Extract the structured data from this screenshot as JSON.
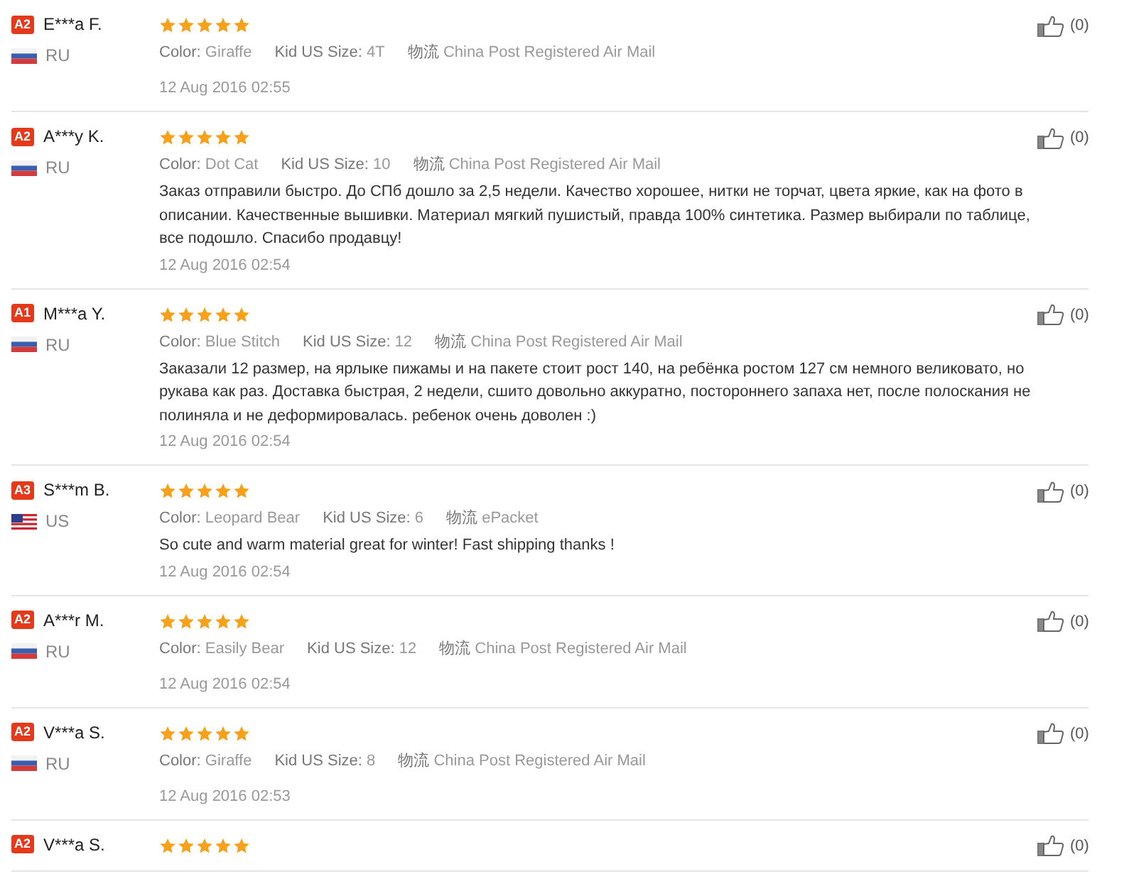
{
  "reviews": [
    {
      "badge": "A2",
      "name": "E***a F.",
      "country": "RU",
      "stars": 5,
      "attributes": [
        {
          "label": "Color:",
          "value": "Giraffe"
        },
        {
          "label": "Kid US Size:",
          "value": "4T"
        },
        {
          "label": "物流",
          "value": "China Post Registered Air Mail"
        }
      ],
      "date": "12 Aug 2016 02:55",
      "likes": "(0)"
    },
    {
      "badge": "A2",
      "name": "A***y K.",
      "country": "RU",
      "stars": 5,
      "attributes": [
        {
          "label": "Color:",
          "value": "Dot Cat"
        },
        {
          "label": "Kid US Size:",
          "value": "10"
        },
        {
          "label": "物流",
          "value": "China Post Registered Air Mail"
        }
      ],
      "text": "Заказ отправили быстро. До СПб дошло за 2,5 недели. Качество хорошее, нитки не торчат, цвета яркие, как на фото в описании. Качественные вышивки. Материал мягкий пушистый, правда 100% синтетика. Размер выбирали по таблице, все подошло. Спасибо продавцу!",
      "date": "12 Aug 2016 02:54",
      "likes": "(0)"
    },
    {
      "badge": "A1",
      "name": "M***a Y.",
      "country": "RU",
      "stars": 5,
      "attributes": [
        {
          "label": "Color:",
          "value": "Blue Stitch"
        },
        {
          "label": "Kid US Size:",
          "value": "12"
        },
        {
          "label": "物流",
          "value": "China Post Registered Air Mail"
        }
      ],
      "text": "Заказали 12 размер, на ярлыке пижамы и на пакете стоит рост 140, на ребёнка ростом 127 см немного великовато, но рукава как раз. Доставка быстрая, 2 недели, сшито довольно аккуратно, постороннего запаха нет, после полоскания не полиняла и не деформировалась. ребенок очень доволен :)",
      "date": "12 Aug 2016 02:54",
      "likes": "(0)"
    },
    {
      "badge": "A3",
      "name": "S***m B.",
      "country": "US",
      "stars": 5,
      "attributes": [
        {
          "label": "Color:",
          "value": "Leopard Bear"
        },
        {
          "label": "Kid US Size:",
          "value": "6"
        },
        {
          "label": "物流",
          "value": "ePacket"
        }
      ],
      "text": "So cute and warm material great for winter! Fast shipping thanks !",
      "date": "12 Aug 2016 02:54",
      "likes": "(0)"
    },
    {
      "badge": "A2",
      "name": "A***r M.",
      "country": "RU",
      "stars": 5,
      "attributes": [
        {
          "label": "Color:",
          "value": "Easily Bear"
        },
        {
          "label": "Kid US Size:",
          "value": "12"
        },
        {
          "label": "物流",
          "value": "China Post Registered Air Mail"
        }
      ],
      "date": "12 Aug 2016 02:54",
      "likes": "(0)"
    },
    {
      "badge": "A2",
      "name": "V***a S.",
      "country": "RU",
      "stars": 5,
      "attributes": [
        {
          "label": "Color:",
          "value": "Giraffe"
        },
        {
          "label": "Kid US Size:",
          "value": "8"
        },
        {
          "label": "物流",
          "value": "China Post Registered Air Mail"
        }
      ],
      "date": "12 Aug 2016 02:53",
      "likes": "(0)"
    },
    {
      "badge": "A2",
      "name": "V***a S.",
      "stars": 5,
      "likes": "(0)"
    }
  ]
}
